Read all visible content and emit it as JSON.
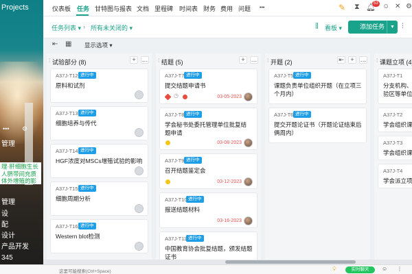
{
  "sidebar": {
    "project_title": "Projects",
    "items": [
      "管理",
      "设",
      "配",
      "设计",
      "产品开发",
      "345"
    ],
    "highlight": [
      "理·肝细胞生长",
      "人脐带间充质",
      "体外增殖的影"
    ],
    "icon_left": "ellipsis",
    "icon_right": "settings"
  },
  "topnav": {
    "items": [
      "仪表板",
      "任务",
      "甘特图与报表",
      "文档",
      "里程碑",
      "时间表",
      "财务",
      "费用",
      "问题"
    ],
    "active": "任务",
    "more": "•••",
    "badge": "53"
  },
  "subbar": {
    "task_list": "任务列表",
    "filter": "所有未关闭的",
    "view": "看板",
    "add_task": "添加任务"
  },
  "toolbar": {
    "display_options": "显示选项"
  },
  "columns": [
    {
      "title": "试验部分 (8)",
      "cards": [
        {
          "id": "A37J-T12",
          "status": "进行中",
          "title": "原料和试剂"
        },
        {
          "id": "A37J-T13",
          "status": "进行中",
          "title": "细胞培养与传代"
        },
        {
          "id": "A37J-T14",
          "status": "进行中",
          "title": "HGF浓度对MSCs增殖试验的影响"
        },
        {
          "id": "A37J-T15",
          "status": "进行中",
          "title": "细胞周期分析"
        },
        {
          "id": "A37J-T16",
          "status": "进行中",
          "title": "Western blot检测"
        }
      ]
    },
    {
      "title": "结题 (5)",
      "cards": [
        {
          "id": "A37J-T7",
          "status": "进行中",
          "title": "提交结题申请书",
          "date": "03-05-2023"
        },
        {
          "id": "A37J-T8",
          "status": "进行中",
          "title": "学会秘书处委托管理单位批复结题申请",
          "date": "03-08-2023"
        },
        {
          "id": "A37J-T9",
          "status": "进行中",
          "title": "召开结题鉴定会",
          "date": "03-12-2023"
        },
        {
          "id": "A37J-T10",
          "status": "进行中",
          "title": "报送结题材料",
          "date": "03-16-2023"
        },
        {
          "id": "A37J-T11",
          "status": "进行中",
          "title": "中国教育协会批复结题，颁发结题证书"
        }
      ]
    },
    {
      "title": "开题 (2)",
      "cards": [
        {
          "id": "A37J-T5",
          "status": "进行中",
          "title": "课题负责单位组织开题（在立项三个月内）"
        },
        {
          "id": "A37J-T6",
          "status": "进行中",
          "title": "提交开题论证书（开题论证结束后俩周内）"
        }
      ]
    },
    {
      "title": "课题立项 (4)",
      "cards": [
        {
          "id": "A37J-T1",
          "title": "分支机构、验区等单位"
        },
        {
          "id": "A37J-T2",
          "title": "学会组织课"
        },
        {
          "id": "A37J-T3",
          "title": "学会组织课"
        },
        {
          "id": "A37J-T4",
          "title": "学会派立项"
        }
      ]
    }
  ],
  "bottom": {
    "search_hint": "这里可能搜索(Ctrl+Space)",
    "chat": "实时聊天"
  },
  "colors": {
    "accent": "#1aa38b",
    "status": "#1f9ee8",
    "date": "#e05252"
  }
}
